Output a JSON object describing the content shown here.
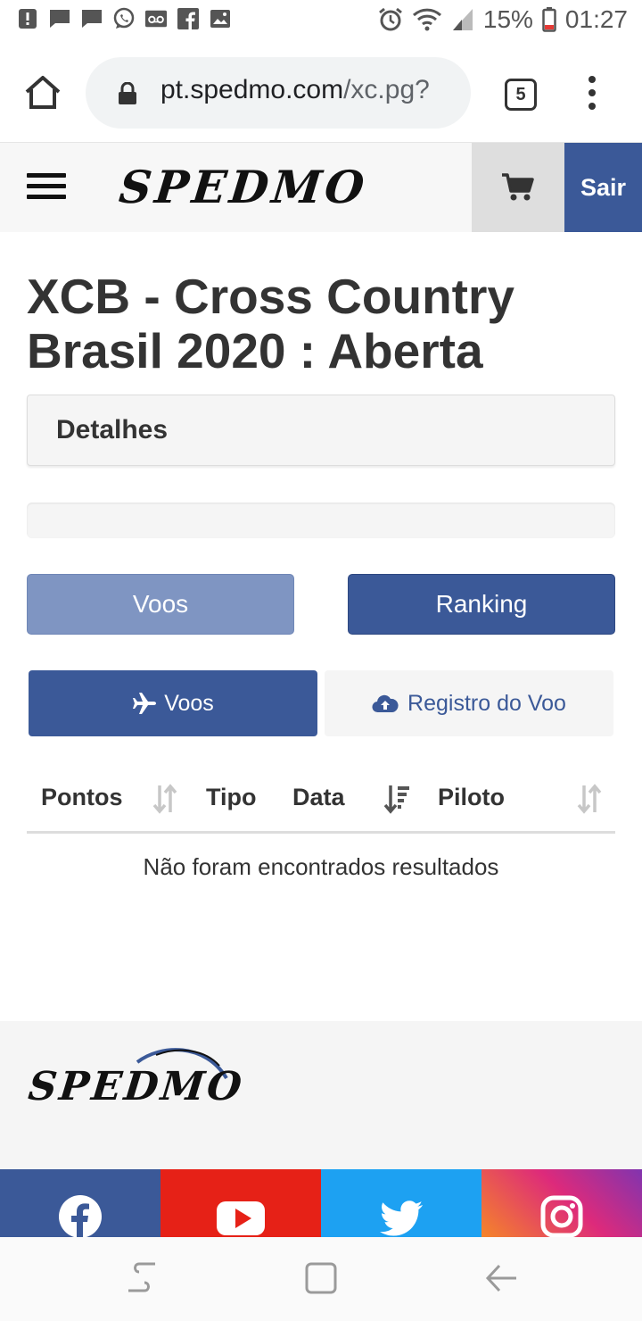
{
  "status_bar": {
    "battery": "15%",
    "time": "01:27"
  },
  "browser": {
    "url_host": "pt.spedmo.com",
    "url_path": "/xc.pg?",
    "tab_count": "5"
  },
  "header": {
    "logo": "SPEDMO",
    "sign_out_label": "Sair"
  },
  "page": {
    "title": "XCB - Cross Country Brasil 2020 : Aberta",
    "details_label": "Detalhes",
    "progress_fraction": 0,
    "voos_button": "Voos",
    "ranking_button": "Ranking",
    "tab_flights": "Voos",
    "tab_register": "Registro do Voo"
  },
  "table": {
    "columns": [
      "Pontos",
      "Tipo",
      "Data",
      "Piloto"
    ],
    "empty_message": "Não foram encontrados resultados"
  },
  "footer": {
    "logo": "SPEDMO",
    "social": [
      "facebook-icon",
      "youtube-icon",
      "twitter-icon",
      "instagram-icon"
    ]
  },
  "colors": {
    "brand_blue": "#3b5998",
    "light_blue": "#7f95c2",
    "facebook": "#3b5998",
    "youtube": "#e62117",
    "twitter": "#1da1f2"
  }
}
